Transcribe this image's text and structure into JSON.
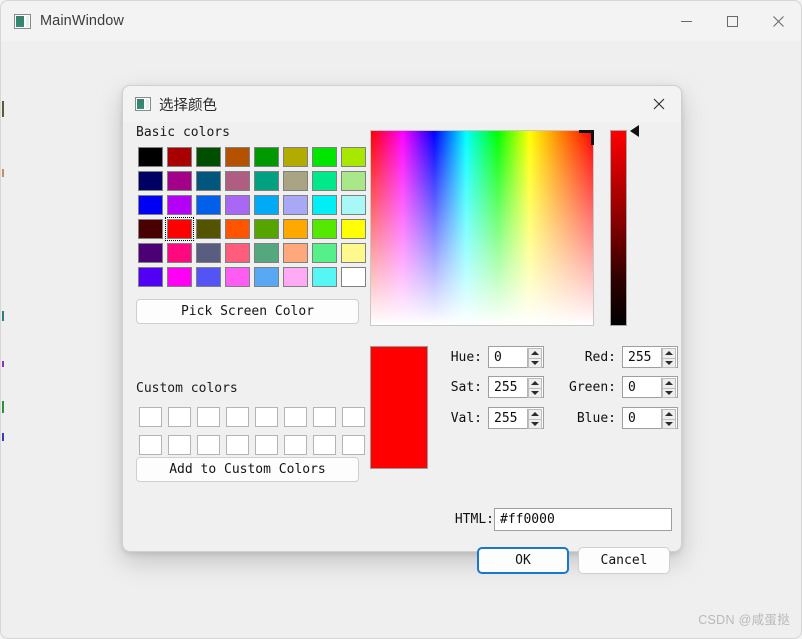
{
  "main_window": {
    "title": "MainWindow",
    "icon": "app-window-icon",
    "controls": {
      "minimize": "minimize-icon",
      "maximize": "maximize-icon",
      "close": "close-icon"
    }
  },
  "watermark": {
    "text": "CSDN @咸蛋挞"
  },
  "dialog": {
    "title": "选择颜色",
    "icon": "app-window-icon",
    "close_icon": "close-icon",
    "basic_colors": {
      "label": "Basic colors",
      "selected_index": 25,
      "swatches": [
        "#000000",
        "#a80000",
        "#004f00",
        "#b45200",
        "#009a00",
        "#b3ac00",
        "#00e600",
        "#a8e800",
        "#000064",
        "#a3008a",
        "#00567d",
        "#b05d82",
        "#00a080",
        "#a8a484",
        "#00e88a",
        "#a8e888",
        "#0000f4",
        "#b400f4",
        "#0060ea",
        "#a868f4",
        "#00aaf4",
        "#a8a8f4",
        "#00eff4",
        "#a8f8f8",
        "#480000",
        "#ff0000",
        "#545400",
        "#ff5500",
        "#55a400",
        "#ffa800",
        "#55e800",
        "#ffff00",
        "#4c0076",
        "#ff0880",
        "#595d80",
        "#ff5d7b",
        "#55a87e",
        "#ffa87e",
        "#55f089",
        "#fff88c",
        "#5100f4",
        "#ff00f4",
        "#5454f4",
        "#ff5cf4",
        "#58a8f4",
        "#ffaaf4",
        "#55f6f4",
        "#ffffff"
      ]
    },
    "pick_screen_color": "Pick Screen Color",
    "custom_colors": {
      "label": "Custom colors",
      "swatches": [
        "#ffffff",
        "#ffffff",
        "#ffffff",
        "#ffffff",
        "#ffffff",
        "#ffffff",
        "#ffffff",
        "#ffffff",
        "#ffffff",
        "#ffffff",
        "#ffffff",
        "#ffffff",
        "#ffffff",
        "#ffffff",
        "#ffffff",
        "#ffffff"
      ]
    },
    "add_to_custom_colors": "Add to Custom Colors",
    "preview_color": "#ff0000",
    "fields": {
      "hue": {
        "label": "Hue:",
        "value": "0"
      },
      "sat": {
        "label": "Sat:",
        "value": "255"
      },
      "val": {
        "label": "Val:",
        "value": "255"
      },
      "red": {
        "label": "Red:",
        "value": "255"
      },
      "green": {
        "label": "Green:",
        "value": "0"
      },
      "blue": {
        "label": "Blue:",
        "value": "0"
      },
      "html": {
        "label": "HTML:",
        "value": "#ff0000"
      }
    },
    "buttons": {
      "ok": "OK",
      "cancel": "Cancel"
    }
  },
  "colors": {
    "accent": "#1a77c9",
    "dialog_bg": "#f0f0f0",
    "window_bg": "#efefef",
    "titlebar_bg": "#f3f3f3",
    "selected": "#ff0000"
  }
}
